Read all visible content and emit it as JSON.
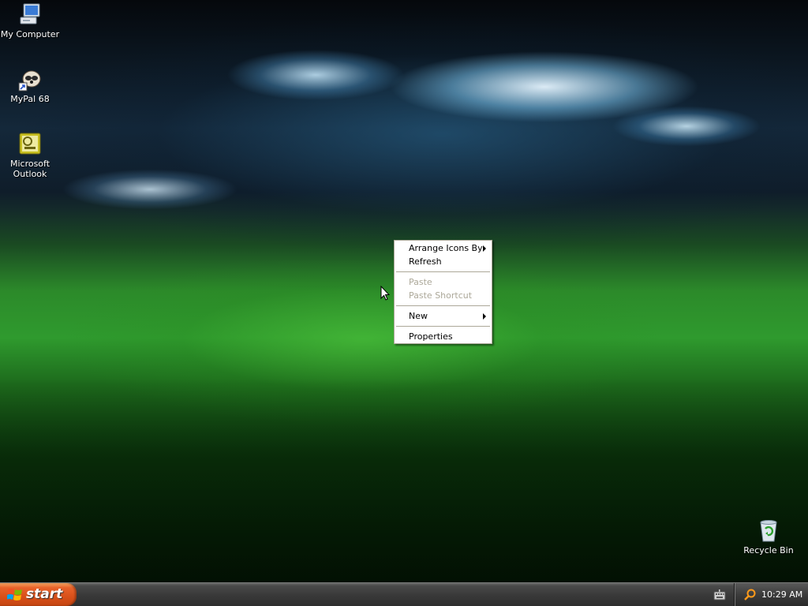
{
  "desktop": {
    "icons": [
      {
        "label": "My Computer",
        "icon": "my-computer-icon"
      },
      {
        "label": "MyPal 68",
        "icon": "mypal-browser-icon"
      },
      {
        "label": "Microsoft\nOutlook",
        "icon": "outlook-icon"
      },
      {
        "label": "Recycle Bin",
        "icon": "recycle-bin-icon"
      }
    ]
  },
  "context_menu": {
    "items": [
      {
        "label": "Arrange Icons By",
        "enabled": true,
        "submenu": true
      },
      {
        "label": "Refresh",
        "enabled": true,
        "submenu": false
      },
      {
        "label": "Paste",
        "enabled": false,
        "submenu": false
      },
      {
        "label": "Paste Shortcut",
        "enabled": false,
        "submenu": false
      },
      {
        "label": "New",
        "enabled": true,
        "submenu": true
      },
      {
        "label": "Properties",
        "enabled": true,
        "submenu": false
      }
    ]
  },
  "taskbar": {
    "start_label": "start",
    "clock": "10:29 AM",
    "tray_icons": [
      "keyboard-icon",
      "search-icon"
    ]
  },
  "colors": {
    "start_button": "#e8622a",
    "taskbar": "#3a3a3a",
    "menu_disabled_text": "#aca899",
    "menu_border": "#aca899"
  }
}
